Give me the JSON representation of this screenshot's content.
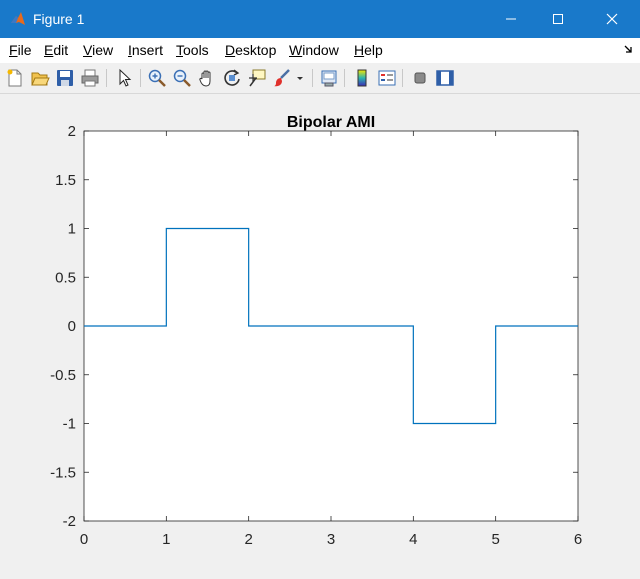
{
  "window": {
    "title": "Figure 1",
    "minimize_icon": "minimize-icon",
    "maximize_icon": "maximize-icon",
    "close_icon": "close-icon",
    "accent": "#1979ca"
  },
  "menu": {
    "items": [
      {
        "mnemonic": "F",
        "rest": "ile"
      },
      {
        "mnemonic": "E",
        "rest": "dit"
      },
      {
        "mnemonic": "V",
        "rest": "iew"
      },
      {
        "mnemonic": "I",
        "rest": "nsert"
      },
      {
        "mnemonic": "T",
        "rest": "ools"
      },
      {
        "mnemonic": "D",
        "rest": "esktop"
      },
      {
        "mnemonic": "W",
        "rest": "indow"
      },
      {
        "mnemonic": "H",
        "rest": "elp"
      }
    ],
    "dock_icon": "dock-arrow-icon"
  },
  "toolbar": {
    "icons": [
      "new-figure-icon",
      "open-file-icon",
      "save-icon",
      "print-icon",
      "edit-plot-arrow-icon",
      "zoom-in-icon",
      "zoom-out-icon",
      "pan-hand-icon",
      "rotate-3d-icon",
      "data-cursor-icon",
      "brush-icon",
      "brush-dropdown-icon",
      "link-plot-icon",
      "insert-colorbar-icon",
      "insert-legend-icon",
      "hide-plot-tools-icon",
      "show-plot-tools-icon"
    ]
  },
  "chart_data": {
    "type": "line",
    "title": "Bipolar AMI",
    "xlabel": "",
    "ylabel": "",
    "xlim": [
      0,
      6
    ],
    "ylim": [
      -2,
      2
    ],
    "xticks": [
      "0",
      "1",
      "2",
      "3",
      "4",
      "5",
      "6"
    ],
    "yticks": [
      "2",
      "1.5",
      "1",
      "0.5",
      "0",
      "-0.5",
      "-1",
      "-1.5",
      "-2"
    ],
    "grid": false,
    "series": [
      {
        "color": "#0072bd",
        "x": [
          0,
          1,
          1,
          2,
          2,
          4,
          4,
          5,
          5,
          6
        ],
        "y": [
          0,
          0,
          1,
          1,
          0,
          0,
          -1,
          -1,
          0,
          0
        ]
      }
    ]
  }
}
